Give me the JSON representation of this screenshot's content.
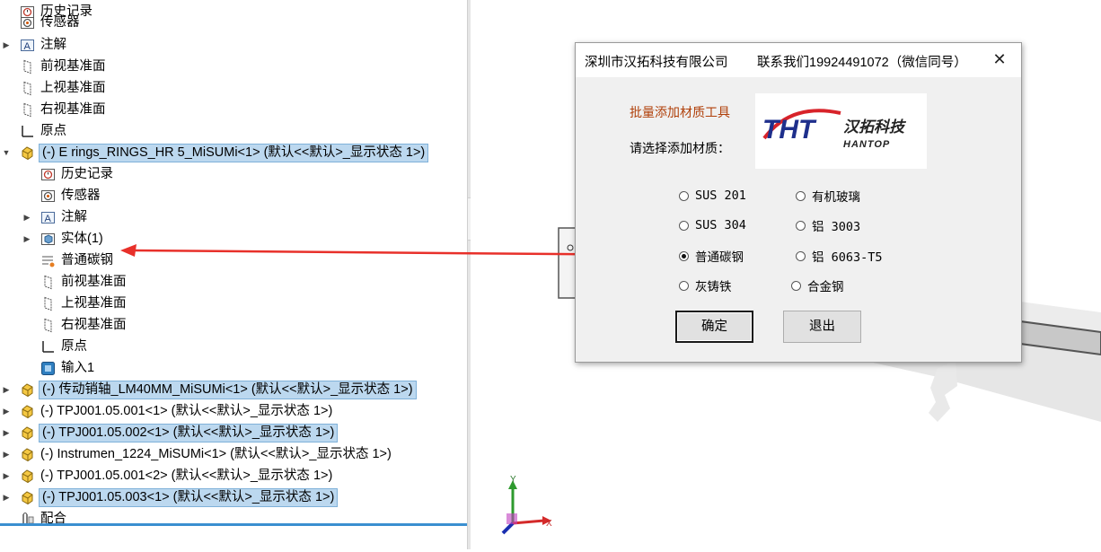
{
  "tree": {
    "items": [
      {
        "label": "历史记录",
        "icon": "history-icon",
        "expandable": false,
        "selected": false
      },
      {
        "label": "传感器",
        "icon": "sensor-icon",
        "expandable": false,
        "selected": false
      },
      {
        "label": "注解",
        "icon": "annotation-icon",
        "expandable": true,
        "selected": false
      },
      {
        "label": "前视基准面",
        "icon": "plane-icon",
        "expandable": false,
        "selected": false
      },
      {
        "label": "上视基准面",
        "icon": "plane-icon",
        "expandable": false,
        "selected": false
      },
      {
        "label": "右视基准面",
        "icon": "plane-icon",
        "expandable": false,
        "selected": false
      },
      {
        "label": "原点",
        "icon": "origin-icon",
        "expandable": false,
        "selected": false
      },
      {
        "label": "(-) E rings_RINGS_HR 5_MiSUMi<1> (默认<<默认>_显示状态 1>)",
        "icon": "part-icon",
        "expandable": true,
        "expanded": true,
        "selected": true
      },
      {
        "label": "历史记录",
        "icon": "history-icon",
        "expandable": false,
        "selected": false
      },
      {
        "label": "传感器",
        "icon": "sensor-icon",
        "expandable": false,
        "selected": false
      },
      {
        "label": "注解",
        "icon": "annotation-icon",
        "expandable": true,
        "selected": false
      },
      {
        "label": "实体(1)",
        "icon": "solid-body-icon",
        "expandable": true,
        "selected": false
      },
      {
        "label": "普通碳钢",
        "icon": "material-icon",
        "expandable": false,
        "selected": false
      },
      {
        "label": "前视基准面",
        "icon": "plane-icon",
        "expandable": false,
        "selected": false
      },
      {
        "label": "上视基准面",
        "icon": "plane-icon",
        "expandable": false,
        "selected": false
      },
      {
        "label": "右视基准面",
        "icon": "plane-icon",
        "expandable": false,
        "selected": false
      },
      {
        "label": "原点",
        "icon": "origin-icon",
        "expandable": false,
        "selected": false
      },
      {
        "label": "输入1",
        "icon": "import-icon",
        "expandable": false,
        "selected": false
      },
      {
        "label": "(-) 传动销轴_LM40MM_MiSUMi<1> (默认<<默认>_显示状态 1>)",
        "icon": "part-icon",
        "expandable": true,
        "selected": true
      },
      {
        "label": "(-) TPJ001.05.001<1> (默认<<默认>_显示状态 1>)",
        "icon": "part-icon",
        "expandable": true,
        "selected": false
      },
      {
        "label": "(-) TPJ001.05.002<1> (默认<<默认>_显示状态 1>)",
        "icon": "part-icon",
        "expandable": true,
        "selected": true
      },
      {
        "label": "(-) Instrumen_1224_MiSUMi<1> (默认<<默认>_显示状态 1>)",
        "icon": "part-icon",
        "expandable": true,
        "selected": false
      },
      {
        "label": "(-) TPJ001.05.001<2> (默认<<默认>_显示状态 1>)",
        "icon": "part-icon",
        "expandable": true,
        "selected": false
      },
      {
        "label": "(-) TPJ001.05.003<1> (默认<<默认>_显示状态 1>)",
        "icon": "part-icon",
        "expandable": true,
        "selected": true
      },
      {
        "label": "配合",
        "icon": "mate-icon",
        "expandable": false,
        "selected": false
      }
    ]
  },
  "dialog": {
    "title_company": "深圳市汉拓科技有限公司",
    "title_contact": "联系我们19924491072（微信同号）",
    "tool_name": "批量添加材质工具",
    "prompt": "请选择添加材质：",
    "logo": {
      "mark": "THT",
      "name_cn": "汉拓科技",
      "name_en": "HANTOP"
    },
    "materials": [
      {
        "label": "SUS 201",
        "checked": false
      },
      {
        "label": "有机玻璃",
        "checked": false
      },
      {
        "label": "SUS 304",
        "checked": false
      },
      {
        "label": "铝 3003",
        "checked": false
      },
      {
        "label": "普通碳钢",
        "checked": true
      },
      {
        "label": "铝 6063-T5",
        "checked": false
      },
      {
        "label": "灰铸铁",
        "checked": false
      },
      {
        "label": "合金钢",
        "checked": false
      }
    ],
    "ok_label": "确定",
    "exit_label": "退出"
  },
  "axes": {
    "x": "X",
    "y": "Y"
  },
  "colors": {
    "selection": "#bcd8ef",
    "arrow": "#e8302a",
    "tool_name": "#b0400a",
    "logo_blue": "#1e2f8c",
    "logo_red": "#d8232a",
    "tree_bottom": "#3a8fd0"
  }
}
